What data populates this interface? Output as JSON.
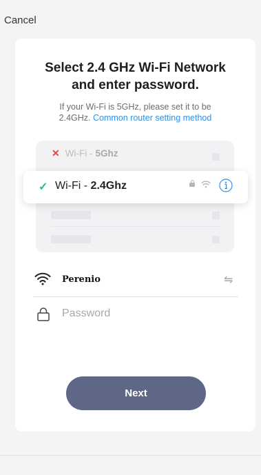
{
  "header": {
    "cancel_label": "Cancel"
  },
  "card": {
    "title_line1": "Select 2.4 GHz Wi-Fi Network",
    "title_line2": "and enter password.",
    "subtitle_line1": "If your Wi-Fi is 5GHz, please set it to be",
    "subtitle_line2_prefix": "2.4GHz.",
    "subtitle_link": "Common router setting method"
  },
  "illustration": {
    "bad_network_prefix": "Wi-Fi -",
    "bad_network_band": "5Ghz",
    "good_network_prefix": "Wi-Fi -",
    "good_network_band": "2.4Ghz",
    "bad_icon": "cross-icon",
    "good_icon": "checkmark-icon"
  },
  "form": {
    "ssid": "Perenio",
    "wifi_icon": "wifi-icon",
    "switch_icon": "switch-network-icon",
    "password_placeholder": "Password",
    "password_value": ""
  },
  "actions": {
    "next_label": "Next"
  },
  "colors": {
    "primary_button": "#5e6785",
    "link": "#2f8fe5",
    "success": "#1ec18a",
    "error": "#e8453c"
  }
}
